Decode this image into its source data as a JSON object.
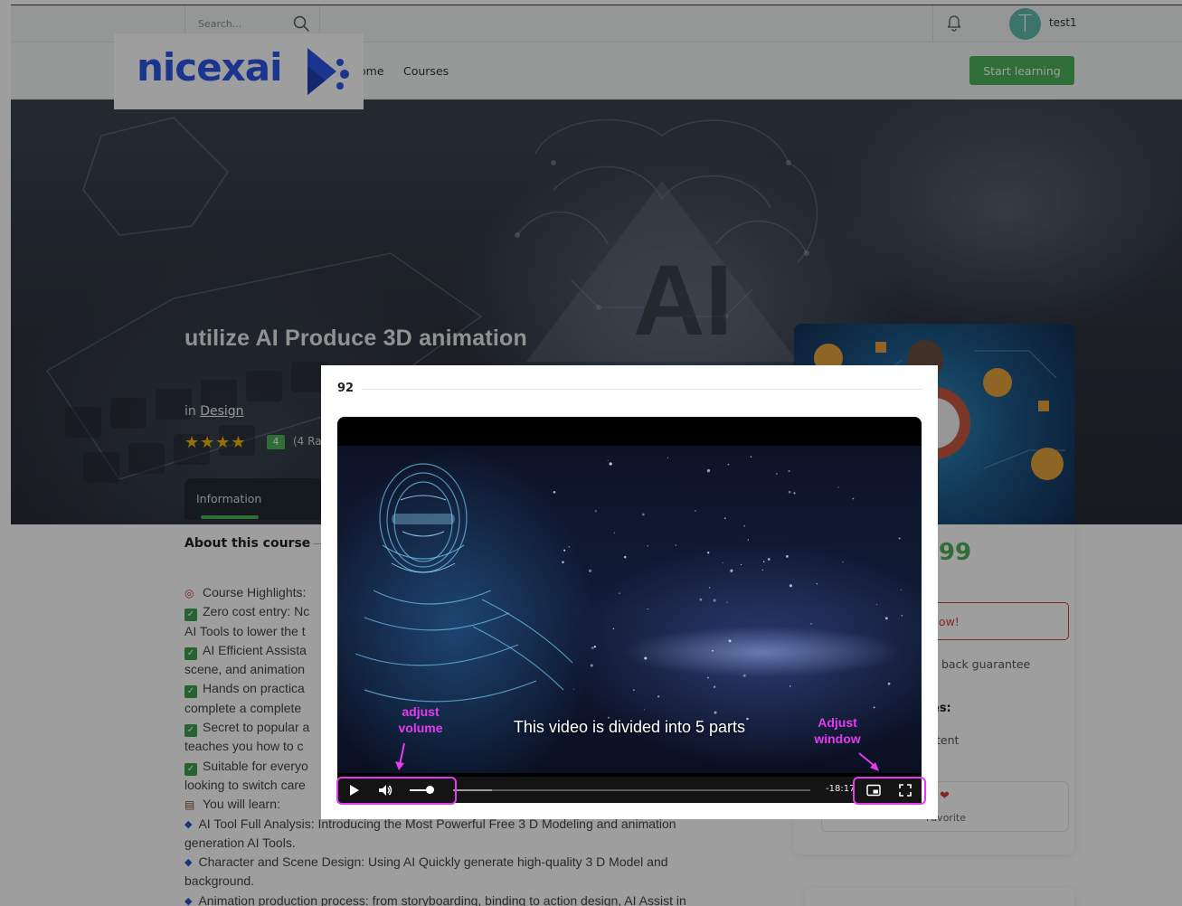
{
  "header": {
    "search_placeholder": "Search...",
    "user_initial": "T",
    "user_name": "test1"
  },
  "logo": {
    "text": "nicexai"
  },
  "nav": {
    "home": "ome",
    "courses": "Courses",
    "start_button": "Start learning"
  },
  "hero": {
    "title": "utilize AI Produce 3D animation",
    "category_prefix": "in ",
    "category": "Design",
    "stars": "★★★★",
    "rating_badge": "4",
    "rating_count": "(4 Ra",
    "tab_label": "Information"
  },
  "course": {
    "about_heading": "About this course",
    "rows": [
      {
        "marker": "emoji",
        "text": "Course Highlights:"
      },
      {
        "marker": "check",
        "text": "Zero cost entry: Nc"
      },
      {
        "marker": "none",
        "text": "AI Tools to lower the t"
      },
      {
        "marker": "check",
        "text": "AI Efficient Assista"
      },
      {
        "marker": "none",
        "text": "scene, and animation"
      },
      {
        "marker": "check",
        "text": "Hands on practica"
      },
      {
        "marker": "none",
        "text": "complete a complete"
      },
      {
        "marker": "check",
        "text": "Secret to popular a"
      },
      {
        "marker": "none",
        "text": "teaches you how to c"
      },
      {
        "marker": "check",
        "text": "Suitable for everyo"
      },
      {
        "marker": "none",
        "text": "looking to switch care"
      },
      {
        "marker": "books",
        "text": "You will learn:"
      },
      {
        "marker": "diamond",
        "text": "AI Tool Full Analysis: Introducing the Most Powerful Free 3 D Modeling and animation"
      },
      {
        "marker": "none",
        "text": "generation AI Tools."
      },
      {
        "marker": "diamond",
        "text": "Character and Scene Design: Using AI Quickly generate high-quality 3 D Model and"
      },
      {
        "marker": "none",
        "text": "background."
      },
      {
        "marker": "diamond",
        "text": "Animation production process: from storyboarding, binding to action design, AI Assist in"
      }
    ]
  },
  "sidebar": {
    "price": ".99",
    "buy_button": "now!",
    "guarantee": "back guarantee",
    "includes_heading": "es:",
    "content_item": "tent",
    "favorite_label": "Favorite"
  },
  "modal": {
    "number": "92",
    "subtitle": "This video is divided into 5 parts",
    "time_remaining": "-18:17",
    "volume_level": 0.8,
    "progress_buffered": 0.11
  },
  "annotations": {
    "volume_note": "adjust volume",
    "window_note": "Adjust window"
  },
  "colors": {
    "brand_green": "#4cb35a",
    "logo_blue": "#2d55e6",
    "annotation_magenta": "#e33cf0",
    "danger_red": "#d83a3a"
  }
}
